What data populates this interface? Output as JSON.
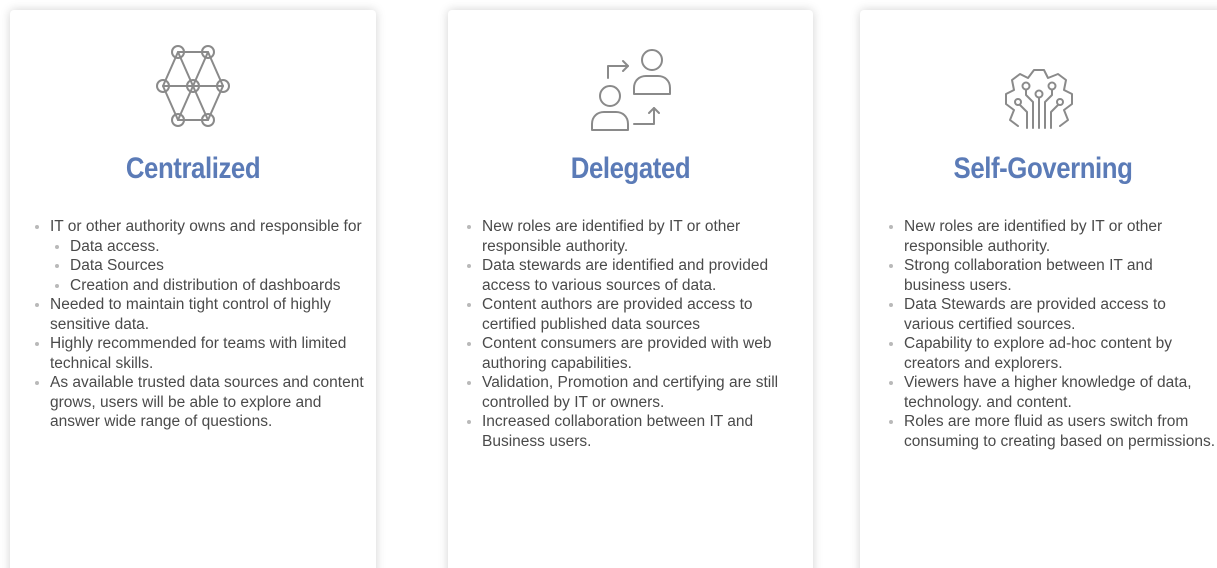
{
  "columns": [
    {
      "title": "Centralized",
      "icon": "network-nodes-icon",
      "bullets": [
        "IT or other authority owns and responsible for",
        "Needed to maintain tight control of highly sensitive data.",
        "Highly recommended for teams with limited technical skills.",
        "As available trusted data sources and content grows, users will be able to explore and answer wide range of questions."
      ],
      "sub_bullets": [
        "Data access.",
        "Data Sources",
        "Creation and distribution of dashboards"
      ]
    },
    {
      "title": "Delegated",
      "icon": "user-transfer-icon",
      "bullets": [
        "New roles are identified by IT or other responsible authority.",
        "Data stewards are identified and provided access to various sources of data.",
        "Content authors are provided access to certified published data sources",
        "Content consumers are provided with web authoring capabilities.",
        "Validation, Promotion and certifying are still controlled by IT or owners.",
        "Increased collaboration between IT and  Business users."
      ]
    },
    {
      "title": "Self-Governing",
      "icon": "gear-circuit-icon",
      "bullets": [
        "New roles are identified by IT or other responsible authority.",
        "Strong collaboration between IT and business users.",
        "Data Stewards are provided access to various  certified sources.",
        "Capability to explore ad-hoc content by creators and explorers.",
        "Viewers have a higher knowledge of data, technology. and content.",
        "Roles are more fluid as users switch from consuming to creating based on permissions."
      ]
    }
  ],
  "colors": {
    "title": "#5b7bb7",
    "body_text": "#4a4a4a",
    "icon_stroke": "#8a8a8a",
    "bullet_dot": "#b9b9b9"
  }
}
